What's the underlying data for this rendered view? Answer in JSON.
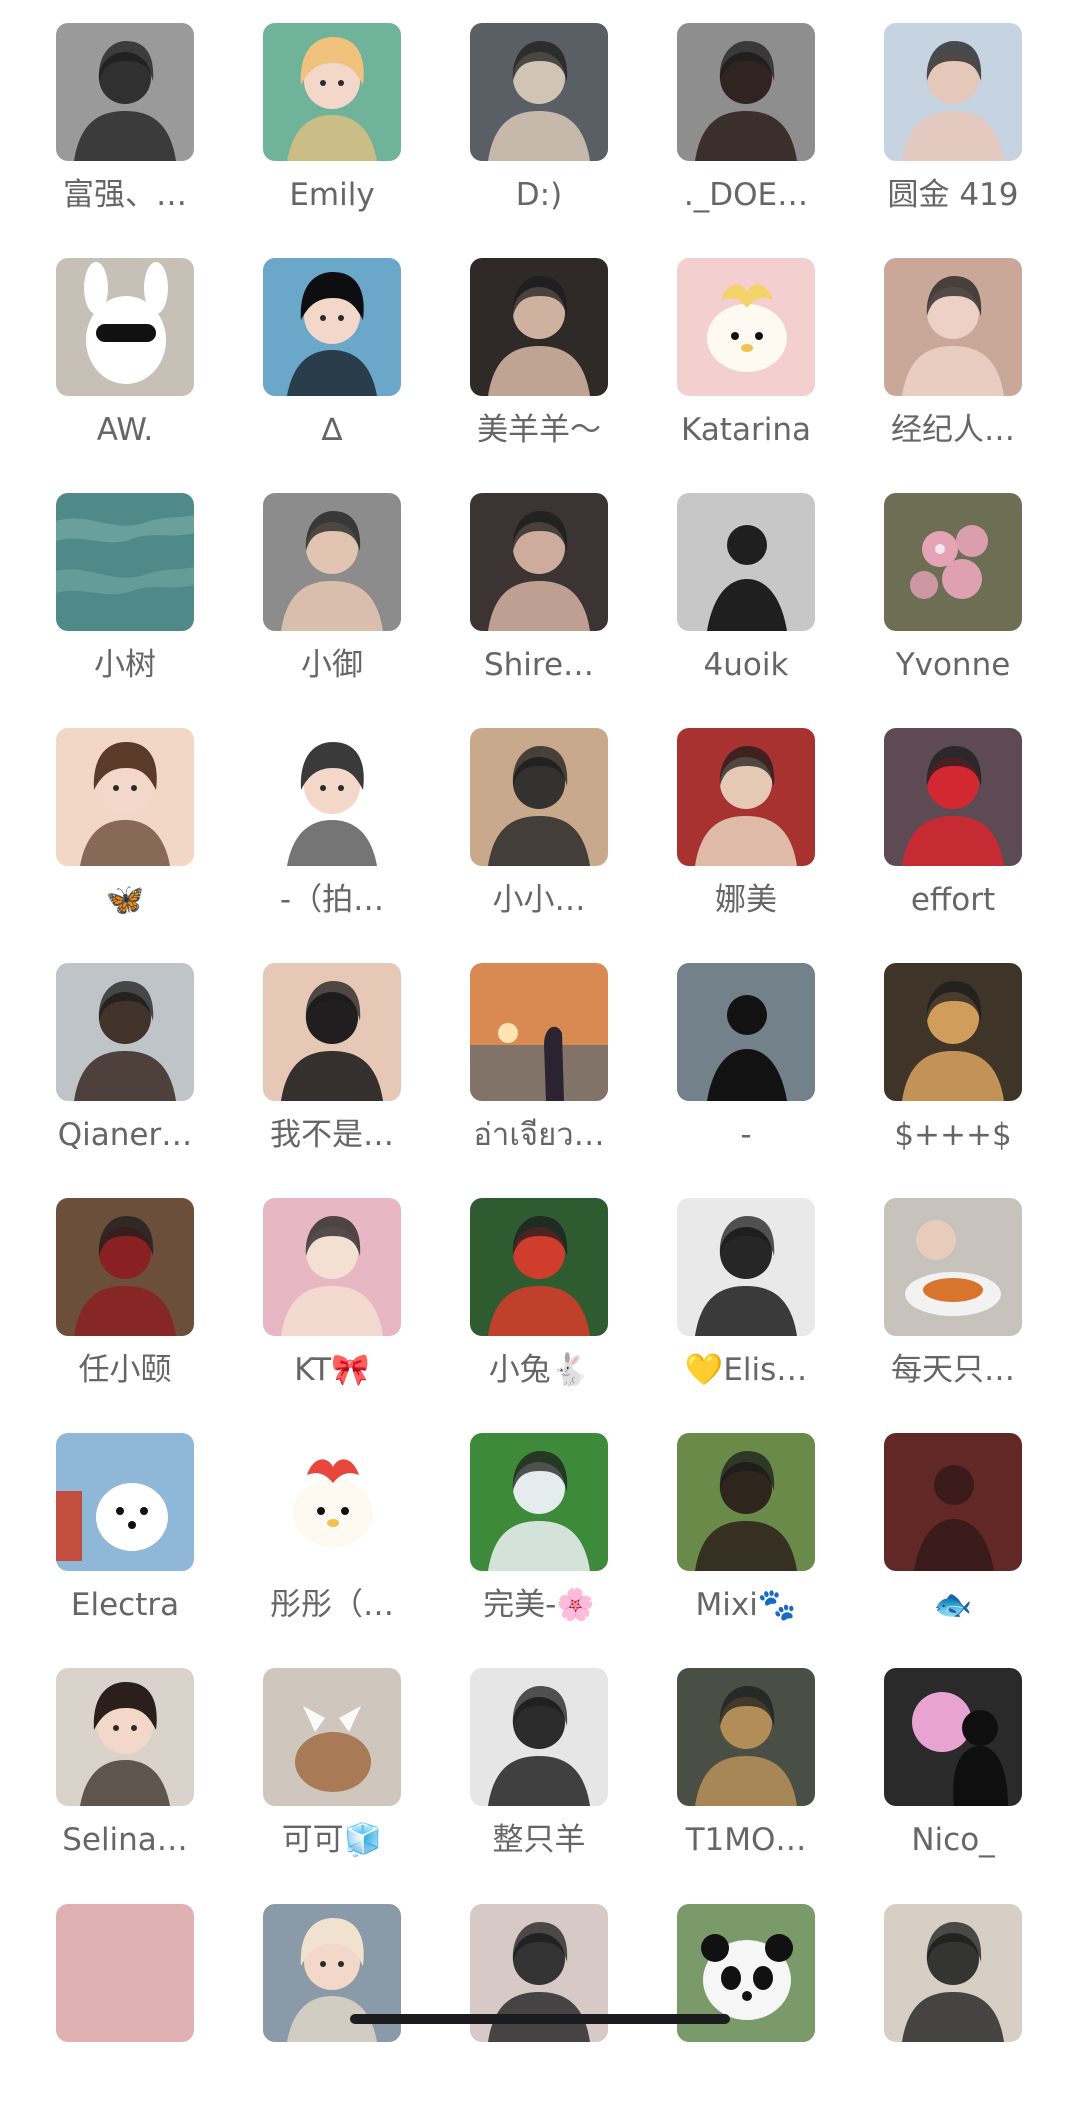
{
  "members": [
    {
      "name": "富强、…",
      "avatar": {
        "bg": "#9a9a9a",
        "fg": "#2a2a2a",
        "kind": "person"
      }
    },
    {
      "name": "Emily",
      "avatar": {
        "bg": "#6fb39a",
        "fg": "#f1c27d",
        "kind": "anime"
      }
    },
    {
      "name": "D:)",
      "avatar": {
        "bg": "#5a5f66",
        "fg": "#d9c9b8",
        "kind": "person"
      }
    },
    {
      "name": "._DOE…",
      "avatar": {
        "bg": "#8e8e8e",
        "fg": "#2b1f1a",
        "kind": "person"
      }
    },
    {
      "name": "圆金 419",
      "avatar": {
        "bg": "#c6d3e0",
        "fg": "#e8c7b8",
        "kind": "person"
      }
    },
    {
      "name": "AW.",
      "avatar": {
        "bg": "#c7c0b6",
        "fg": "#ffffff",
        "kind": "plush"
      }
    },
    {
      "name": "∆",
      "avatar": {
        "bg": "#6aa7c9",
        "fg": "#0e0e12",
        "kind": "anime"
      }
    },
    {
      "name": "美羊羊～",
      "avatar": {
        "bg": "#2f2a28",
        "fg": "#d8b8a6",
        "kind": "person"
      }
    },
    {
      "name": "Katarina",
      "avatar": {
        "bg": "#f3cfd0",
        "fg": "#f5d36a",
        "kind": "cartoon"
      }
    },
    {
      "name": "经纪人…",
      "avatar": {
        "bg": "#c9a89a",
        "fg": "#f0d3c8",
        "kind": "person"
      }
    },
    {
      "name": "小树",
      "avatar": {
        "bg": "#4f8a88",
        "fg": "#7fb3ad",
        "kind": "water"
      }
    },
    {
      "name": "小御",
      "avatar": {
        "bg": "#8c8c8c",
        "fg": "#e6c7b3",
        "kind": "person"
      }
    },
    {
      "name": "Shire…",
      "avatar": {
        "bg": "#3b3432",
        "fg": "#d6b3a3",
        "kind": "person"
      }
    },
    {
      "name": "4uoik",
      "avatar": {
        "bg": "#d8d8d8",
        "fg": "#1f1f1f",
        "kind": "silhouette"
      }
    },
    {
      "name": "Yvonne",
      "avatar": {
        "bg": "#6d6f55",
        "fg": "#e6a3b6",
        "kind": "flower"
      }
    },
    {
      "name": "🦋",
      "avatar": {
        "bg": "#f2d7c6",
        "fg": "#5b3a2a",
        "kind": "drawing"
      }
    },
    {
      "name": "-（拍…",
      "avatar": {
        "bg": "#ffffff",
        "fg": "#3a3a3a",
        "kind": "drawing"
      }
    },
    {
      "name": "小小…",
      "avatar": {
        "bg": "#c9a98c",
        "fg": "#2b2b2b",
        "kind": "person"
      }
    },
    {
      "name": "娜美",
      "avatar": {
        "bg": "#a8322f",
        "fg": "#e9d2bd",
        "kind": "person"
      }
    },
    {
      "name": "effort",
      "avatar": {
        "bg": "#5e4a52",
        "fg": "#d8262f",
        "kind": "person"
      }
    },
    {
      "name": "Qianer…",
      "avatar": {
        "bg": "#bfc4c8",
        "fg": "#3a2a22",
        "kind": "person"
      }
    },
    {
      "name": "我不是…",
      "avatar": {
        "bg": "#e7c8b7",
        "fg": "#151515",
        "kind": "person"
      }
    },
    {
      "name": "อ่าเจียว…",
      "avatar": {
        "bg": "#d98a52",
        "fg": "#2b2430",
        "kind": "sunset"
      }
    },
    {
      "name": "-",
      "avatar": {
        "bg": "#7c8d96",
        "fg": "#121212",
        "kind": "silhouette"
      }
    },
    {
      "name": "$+++$",
      "avatar": {
        "bg": "#3f3428",
        "fg": "#d9a35e",
        "kind": "person"
      }
    },
    {
      "name": "任小颐",
      "avatar": {
        "bg": "#6b4f3a",
        "fg": "#8b1f22",
        "kind": "person"
      }
    },
    {
      "name": "KT🎀",
      "avatar": {
        "bg": "#e7b7c4",
        "fg": "#f4e1d4",
        "kind": "person"
      }
    },
    {
      "name": "小兔🐇",
      "avatar": {
        "bg": "#2f5b30",
        "fg": "#d83d2c",
        "kind": "person"
      }
    },
    {
      "name": "💛Elis…",
      "avatar": {
        "bg": "#e9e9ea",
        "fg": "#1b1b1b",
        "kind": "person"
      }
    },
    {
      "name": "每天只…",
      "avatar": {
        "bg": "#c8c2bc",
        "fg": "#f2f2f2",
        "kind": "food"
      }
    },
    {
      "name": "Electra",
      "avatar": {
        "bg": "#8fb7d8",
        "fg": "#ffffff",
        "kind": "dog"
      }
    },
    {
      "name": "彤彤（…",
      "avatar": {
        "bg": "#ffffff",
        "fg": "#e8453c",
        "kind": "cartoon"
      }
    },
    {
      "name": "完美-🌸",
      "avatar": {
        "bg": "#3d8a3a",
        "fg": "#eef2f6",
        "kind": "person"
      }
    },
    {
      "name": "Mixi🐾",
      "avatar": {
        "bg": "#6a8a4a",
        "fg": "#2b201a",
        "kind": "person"
      }
    },
    {
      "name": "🐟",
      "avatar": {
        "bg": "#6a2c2a",
        "fg": "#3a1a1a",
        "kind": "silhouette"
      }
    },
    {
      "name": "Selina…",
      "avatar": {
        "bg": "#d9d3cc",
        "fg": "#2a1f1a",
        "kind": "drawing"
      }
    },
    {
      "name": "可可🧊",
      "avatar": {
        "bg": "#cfc7bd",
        "fg": "#a87a55",
        "kind": "cat"
      }
    },
    {
      "name": "整只羊",
      "avatar": {
        "bg": "#e6e6e6",
        "fg": "#222222",
        "kind": "person"
      }
    },
    {
      "name": "T1MO…",
      "avatar": {
        "bg": "#4a4f45",
        "fg": "#b8905a",
        "kind": "person"
      }
    },
    {
      "name": "Nico_",
      "avatar": {
        "bg": "#2a2a2a",
        "fg": "#e8a3d2",
        "kind": "moon"
      }
    },
    {
      "name": "",
      "avatar": {
        "bg": "#e0b1b2",
        "fg": "#e0b1b2",
        "kind": "plain"
      }
    },
    {
      "name": "",
      "avatar": {
        "bg": "#8a9aa8",
        "fg": "#f0e2cf",
        "kind": "drawing"
      }
    },
    {
      "name": "",
      "avatar": {
        "bg": "#d6c9c6",
        "fg": "#2b2b2b",
        "kind": "person"
      }
    },
    {
      "name": "",
      "avatar": {
        "bg": "#7a9a6a",
        "fg": "#111111",
        "kind": "panda"
      }
    },
    {
      "name": "",
      "avatar": {
        "bg": "#d7cfc4",
        "fg": "#2b2b2b",
        "kind": "person"
      }
    }
  ]
}
